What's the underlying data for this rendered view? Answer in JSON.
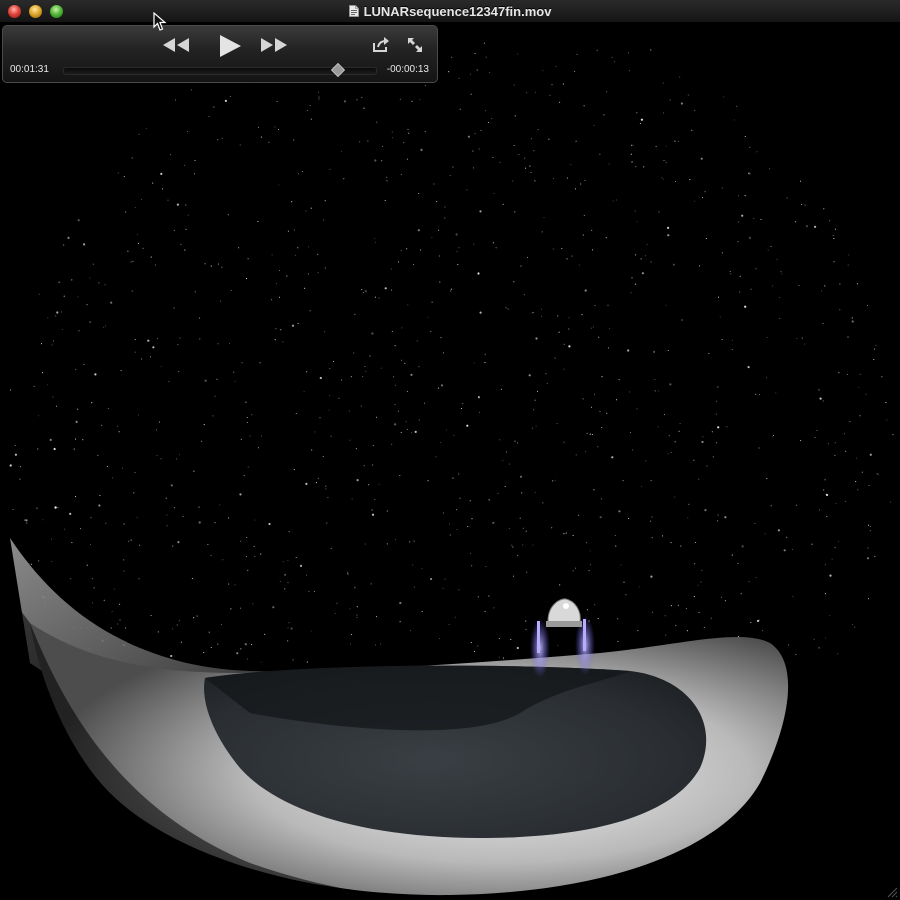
{
  "window": {
    "title": "LUNARsequence12347fin.mov",
    "traffic_lights": {
      "close": {
        "icon": "close-icon",
        "color": "#e0443a"
      },
      "minimize": {
        "icon": "minimize-icon",
        "color": "#e0a92a"
      },
      "zoom": {
        "icon": "zoom-icon",
        "color": "#53b83a"
      }
    },
    "document_icon": "movie-document-icon"
  },
  "player": {
    "controls": {
      "rewind": {
        "icon": "rewind-icon"
      },
      "play": {
        "icon": "play-icon"
      },
      "fast_forward": {
        "icon": "fast-forward-icon"
      },
      "share": {
        "icon": "share-icon"
      },
      "fullscreen": {
        "icon": "fullscreen-icon"
      }
    },
    "time_elapsed": "00:01:31",
    "time_remaining": "-00:00:13",
    "progress": 0.875
  },
  "video": {
    "scene": "starfield-crater-spacecraft",
    "colors": {
      "sky": "#000000",
      "stars": "#ffffff",
      "crater_rim": "#d8d8d8",
      "crater_floor": "#2e3236",
      "thruster_glow": "#8a7cff"
    }
  }
}
